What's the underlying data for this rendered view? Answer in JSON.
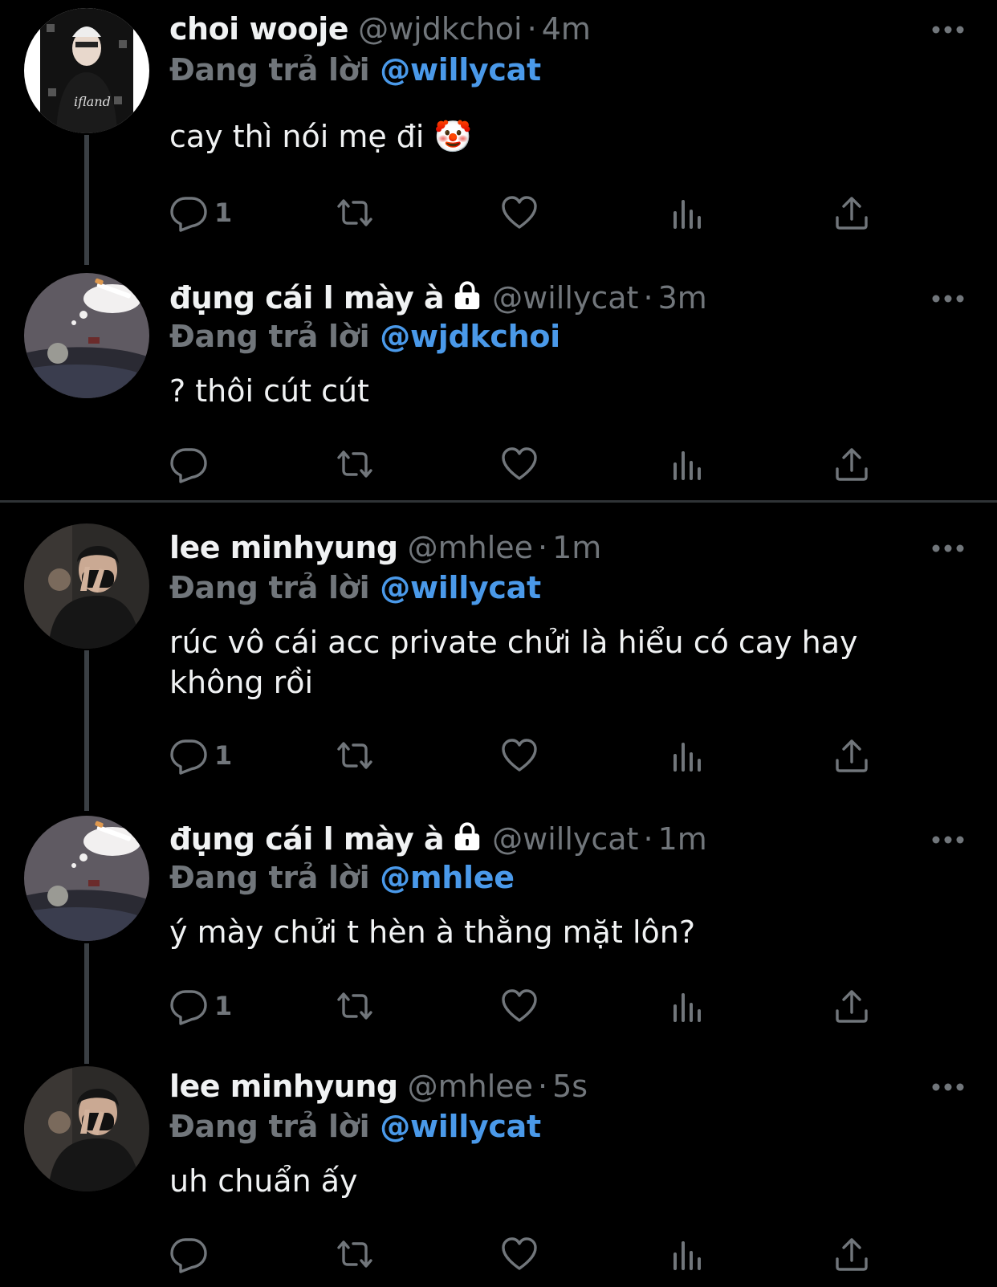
{
  "tweets": [
    {
      "name": "choi wooje",
      "handle": "@wjdkchoi",
      "time": "4m",
      "reply_prefix": "Đang trả lời",
      "reply_to": "@willycat",
      "text": "cay thì nói mẹ đi 🤡",
      "reply_count": "1",
      "locked": false,
      "avatar": "avatar-choi-wooje"
    },
    {
      "name": "đụng cái l mày à",
      "handle": "@willycat",
      "time": "3m",
      "reply_prefix": "Đang trả lời",
      "reply_to": "@wjdkchoi",
      "text": "? thôi cút cút",
      "reply_count": "",
      "locked": true,
      "avatar": "avatar-willycat"
    },
    {
      "name": "lee minhyung",
      "handle": "@mhlee",
      "time": "1m",
      "reply_prefix": "Đang trả lời",
      "reply_to": "@willycat",
      "text": "rúc vô cái acc private chửi là hiểu có cay hay không rồi",
      "reply_count": "1",
      "locked": false,
      "avatar": "avatar-mhlee"
    },
    {
      "name": "đụng cái l mày à",
      "handle": "@willycat",
      "time": "1m",
      "reply_prefix": "Đang trả lời",
      "reply_to": "@mhlee",
      "text": "ý mày chửi t hèn à thằng mặt lôn?",
      "reply_count": "1",
      "locked": true,
      "avatar": "avatar-willycat"
    },
    {
      "name": "lee minhyung",
      "handle": "@mhlee",
      "time": "5s",
      "reply_prefix": "Đang trả lời",
      "reply_to": "@willycat",
      "text": "uh chuẩn ấy",
      "reply_count": "",
      "locked": false,
      "avatar": "avatar-mhlee"
    }
  ],
  "separator_dot": "·",
  "colors": {
    "background": "#000000",
    "text_primary": "#f0f2f3",
    "text_secondary": "#71767b",
    "accent": "#4a99e9",
    "divider": "#2f3336"
  },
  "icons": [
    "reply-icon",
    "retweet-icon",
    "like-icon",
    "views-icon",
    "share-icon",
    "more-icon",
    "lock-icon"
  ]
}
